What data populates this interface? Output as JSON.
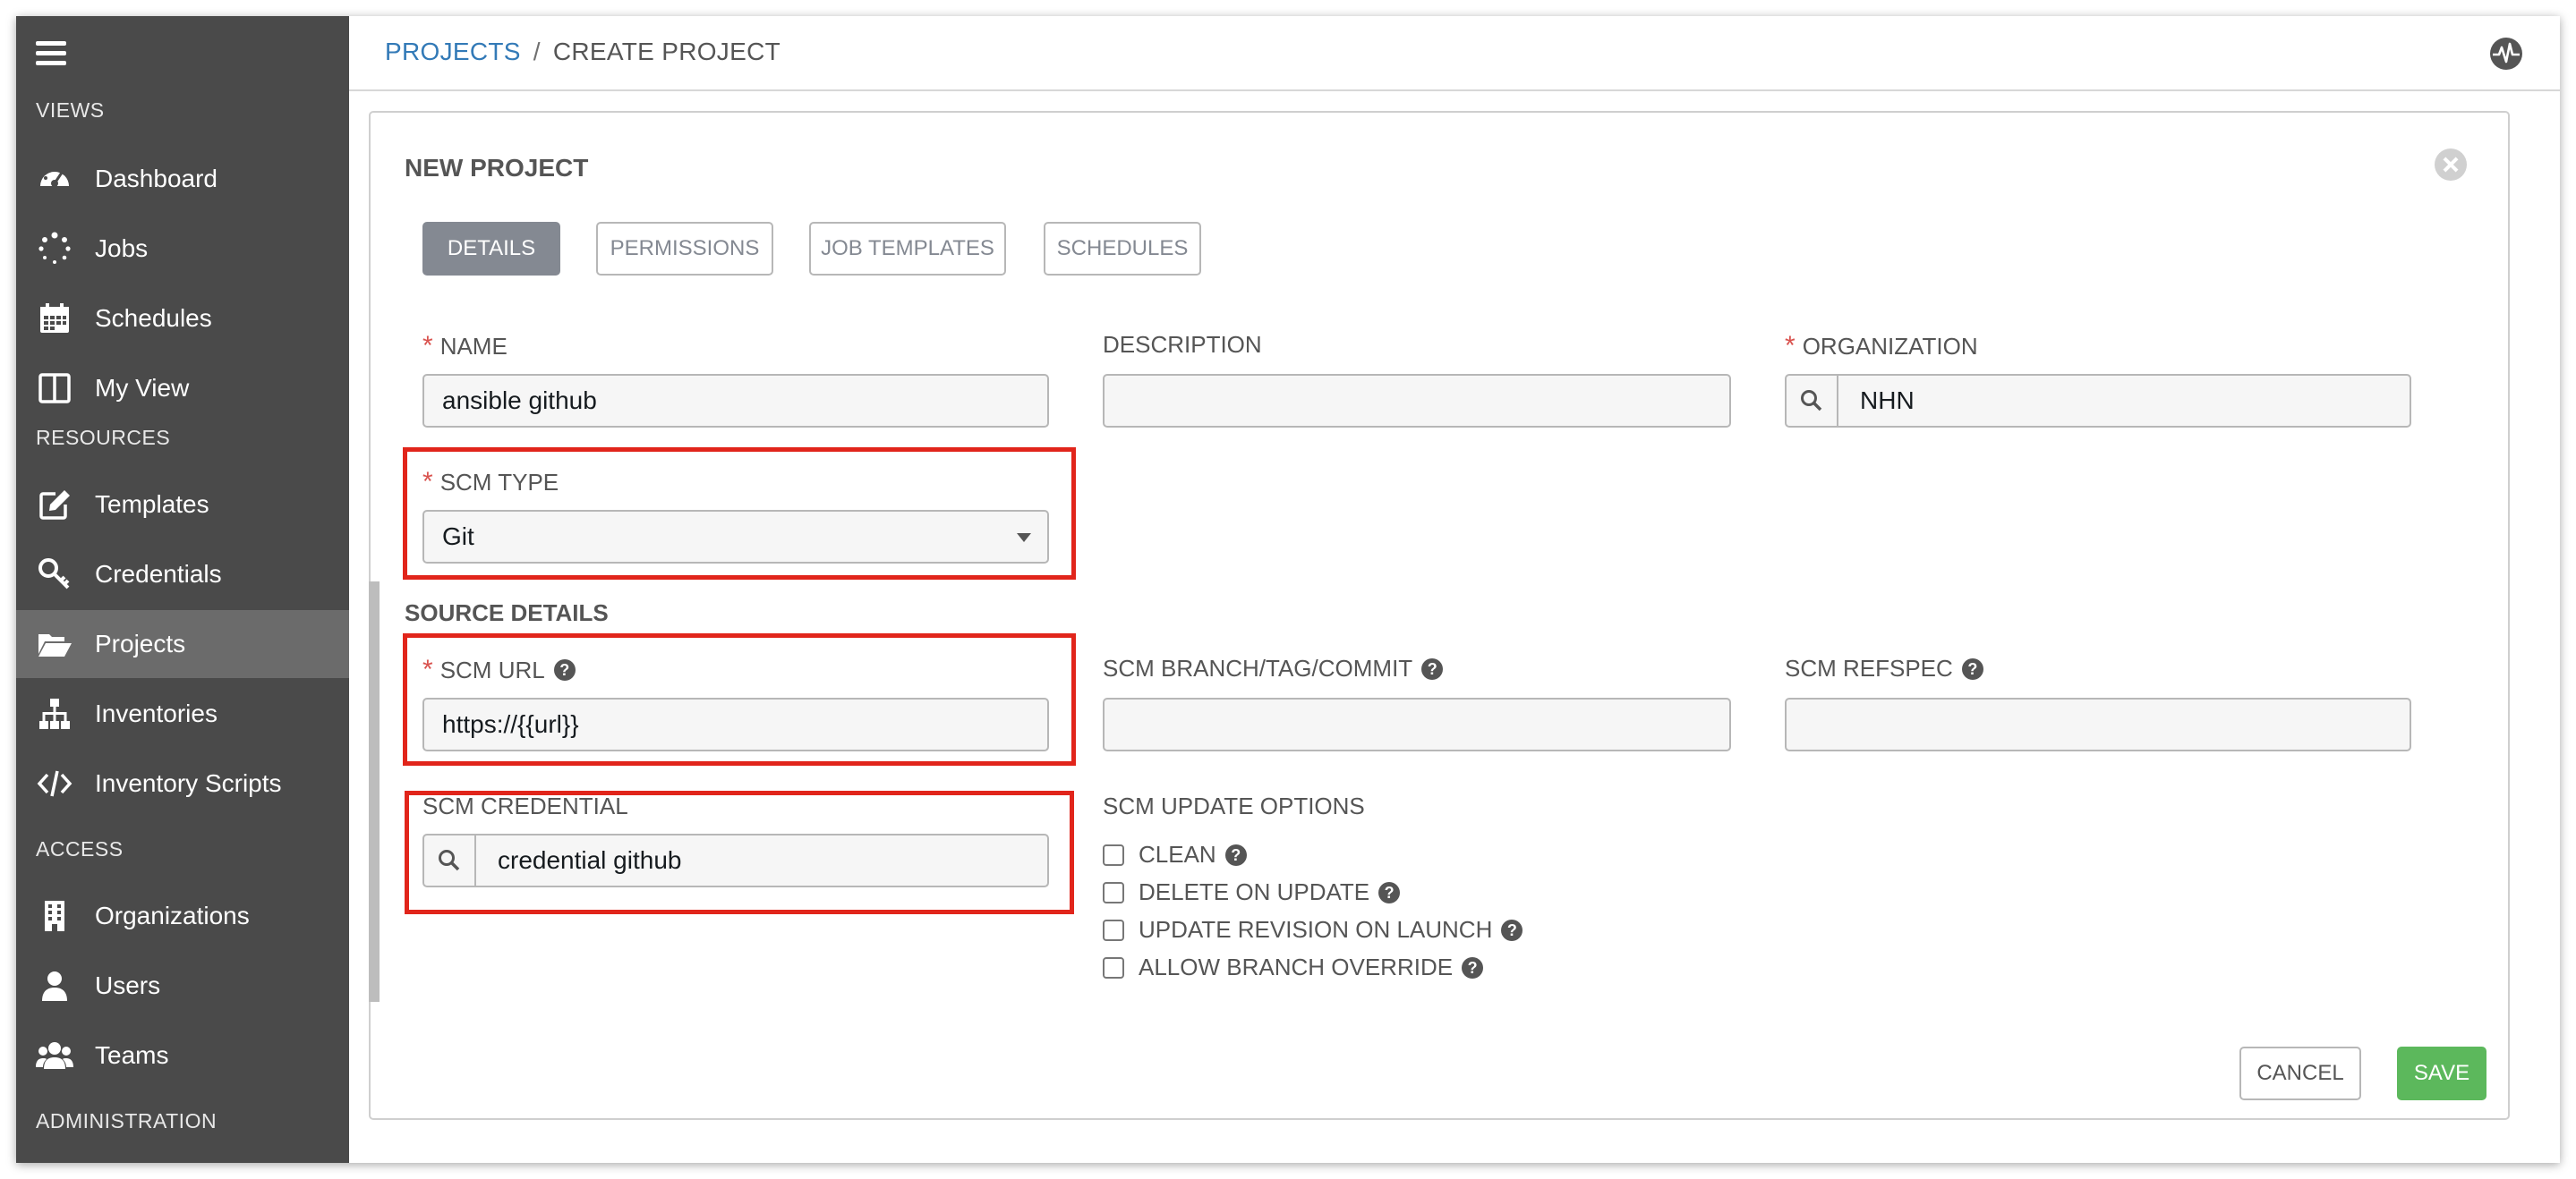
{
  "sidebar": {
    "sections": {
      "views": "VIEWS",
      "resources": "RESOURCES",
      "access": "ACCESS",
      "administration": "ADMINISTRATION"
    },
    "items": {
      "dashboard": "Dashboard",
      "jobs": "Jobs",
      "schedules": "Schedules",
      "my_view": "My View",
      "templates": "Templates",
      "credentials": "Credentials",
      "projects": "Projects",
      "inventories": "Inventories",
      "inventory_scripts": "Inventory Scripts",
      "organizations": "Organizations",
      "users": "Users",
      "teams": "Teams"
    },
    "active_item": "Projects"
  },
  "breadcrumb": {
    "parent": "PROJECTS",
    "separator": "/",
    "current": "CREATE PROJECT"
  },
  "form": {
    "title": "NEW PROJECT",
    "tabs": {
      "details": "DETAILS",
      "permissions": "PERMISSIONS",
      "job_templates": "JOB TEMPLATES",
      "schedules": "SCHEDULES"
    },
    "required_mark": "*",
    "name": {
      "label": "NAME",
      "value": "ansible github"
    },
    "description": {
      "label": "DESCRIPTION",
      "value": ""
    },
    "organization": {
      "label": "ORGANIZATION",
      "value": "NHN"
    },
    "scm_type": {
      "label": "SCM TYPE",
      "value": "Git"
    },
    "source_details": "SOURCE DETAILS",
    "scm_url": {
      "label": "SCM URL",
      "value": "https://{{url}}"
    },
    "scm_branch": {
      "label": "SCM BRANCH/TAG/COMMIT",
      "value": ""
    },
    "scm_refspec": {
      "label": "SCM REFSPEC",
      "value": ""
    },
    "scm_credential": {
      "label": "SCM CREDENTIAL",
      "value": "credential github"
    },
    "update_options": {
      "label": "SCM UPDATE OPTIONS",
      "clean": "CLEAN",
      "delete_on_update": "DELETE ON UPDATE",
      "update_revision_on_launch": "UPDATE REVISION ON LAUNCH",
      "allow_branch_override": "ALLOW BRANCH OVERRIDE"
    },
    "help_glyph": "?",
    "buttons": {
      "cancel": "CANCEL",
      "save": "SAVE"
    }
  },
  "colors": {
    "sidebar_bg": "#4a4a4a",
    "link": "#337ab7",
    "required": "#d9534f",
    "highlight": "#e1251b",
    "save": "#5cb85c",
    "tab_active": "#848992"
  }
}
